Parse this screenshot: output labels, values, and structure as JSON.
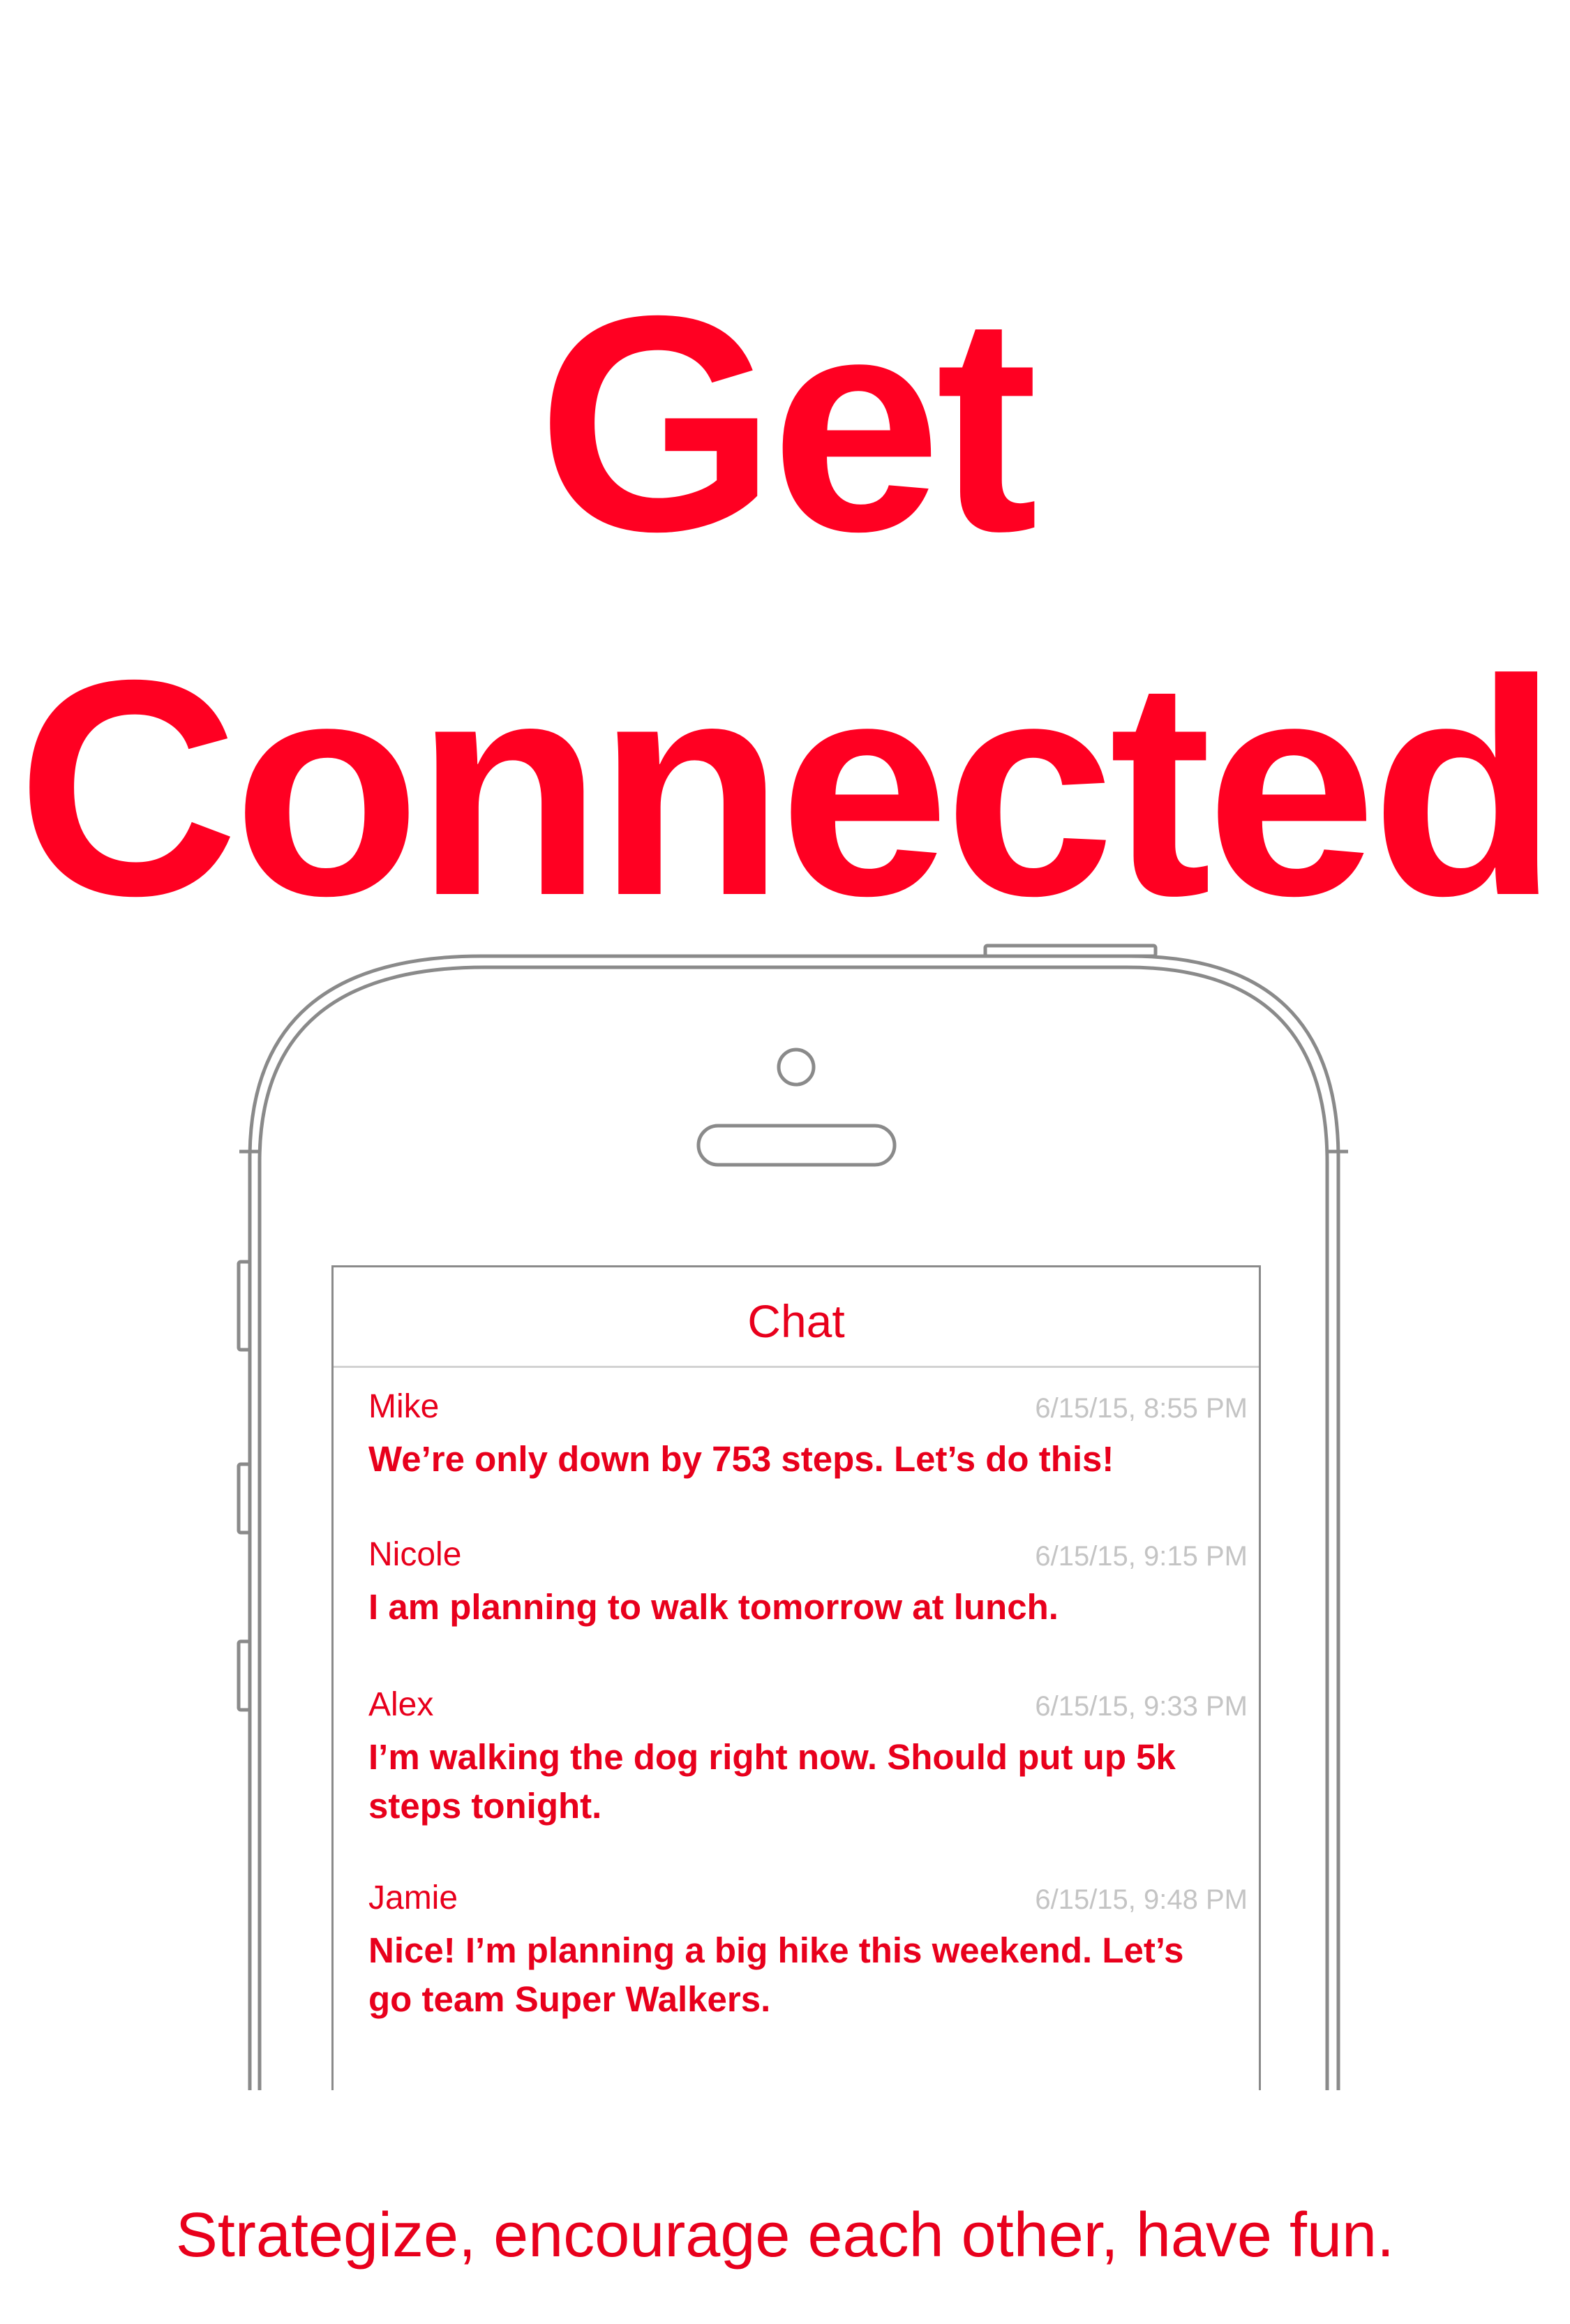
{
  "headline": {
    "line1": "Get",
    "line2": "Connected"
  },
  "chat": {
    "title": "Chat",
    "messages": [
      {
        "author": "Mike",
        "time": "6/15/15, 8:55 PM",
        "text": "We’re only down by 753 steps.  Let’s do this!"
      },
      {
        "author": "Nicole",
        "time": "6/15/15, 9:15 PM",
        "text": "I am planning to walk tomorrow at lunch."
      },
      {
        "author": "Alex",
        "time": "6/15/15, 9:33 PM",
        "text": "I’m walking the dog right now.  Should put up 5k steps tonight."
      },
      {
        "author": "Jamie",
        "time": "6/15/15, 9:48 PM",
        "text": "Nice!  I’m planning a big hike this weekend. Let’s go team Super Walkers."
      }
    ]
  },
  "tagline": "Strategize, encourage each other, have fun.",
  "colors": {
    "accent": "#ff0022",
    "chat_text": "#e8001c",
    "timestamp": "#c4c4c4",
    "device_outline": "#8a8a8a"
  },
  "icons": {
    "device": "phone-outline-icon",
    "camera": "front-camera-icon",
    "speaker": "earpiece-speaker-icon"
  }
}
